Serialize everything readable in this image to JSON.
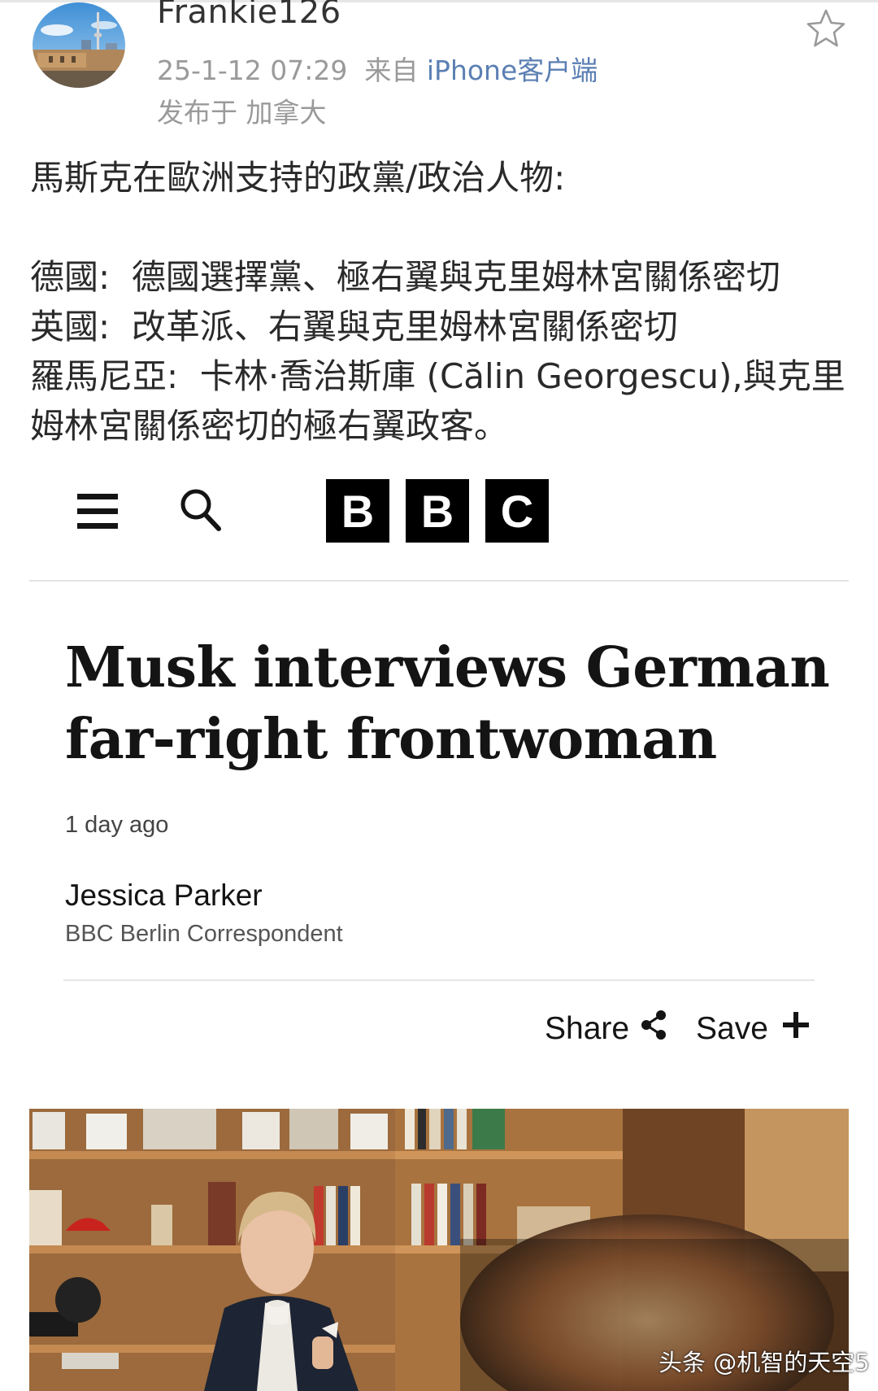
{
  "post": {
    "username": "Frankie126",
    "timestamp": "25-1-12 07:29",
    "source_prefix": "来自",
    "client": "iPhone客户端",
    "location": "发布于 加拿大",
    "body": "馬斯克在歐洲支持的政黨/政治人物:\n\n德國:  德國選擇黨、極右翼與克里姆林宮關係密切\n英國:  改革派、右翼與克里姆林宮關係密切\n羅馬尼亞:  卡林·喬治斯庫 (Călin Georgescu),與克里姆林宮關係密切的極右翼政客。"
  },
  "bbc": {
    "logo_letters": [
      "B",
      "B",
      "C"
    ],
    "headline": "Musk interviews German far-right frontwoman",
    "published": "1 day ago",
    "author": "Jessica Parker",
    "author_role": "BBC Berlin Correspondent",
    "share_label": "Share",
    "save_label": "Save"
  },
  "watermark": "头条 @机智的天空5",
  "icons": {
    "favorite": "star-outline-icon",
    "menu": "hamburger-menu-icon",
    "search": "search-icon",
    "share": "share-icon",
    "save": "plus-icon"
  }
}
